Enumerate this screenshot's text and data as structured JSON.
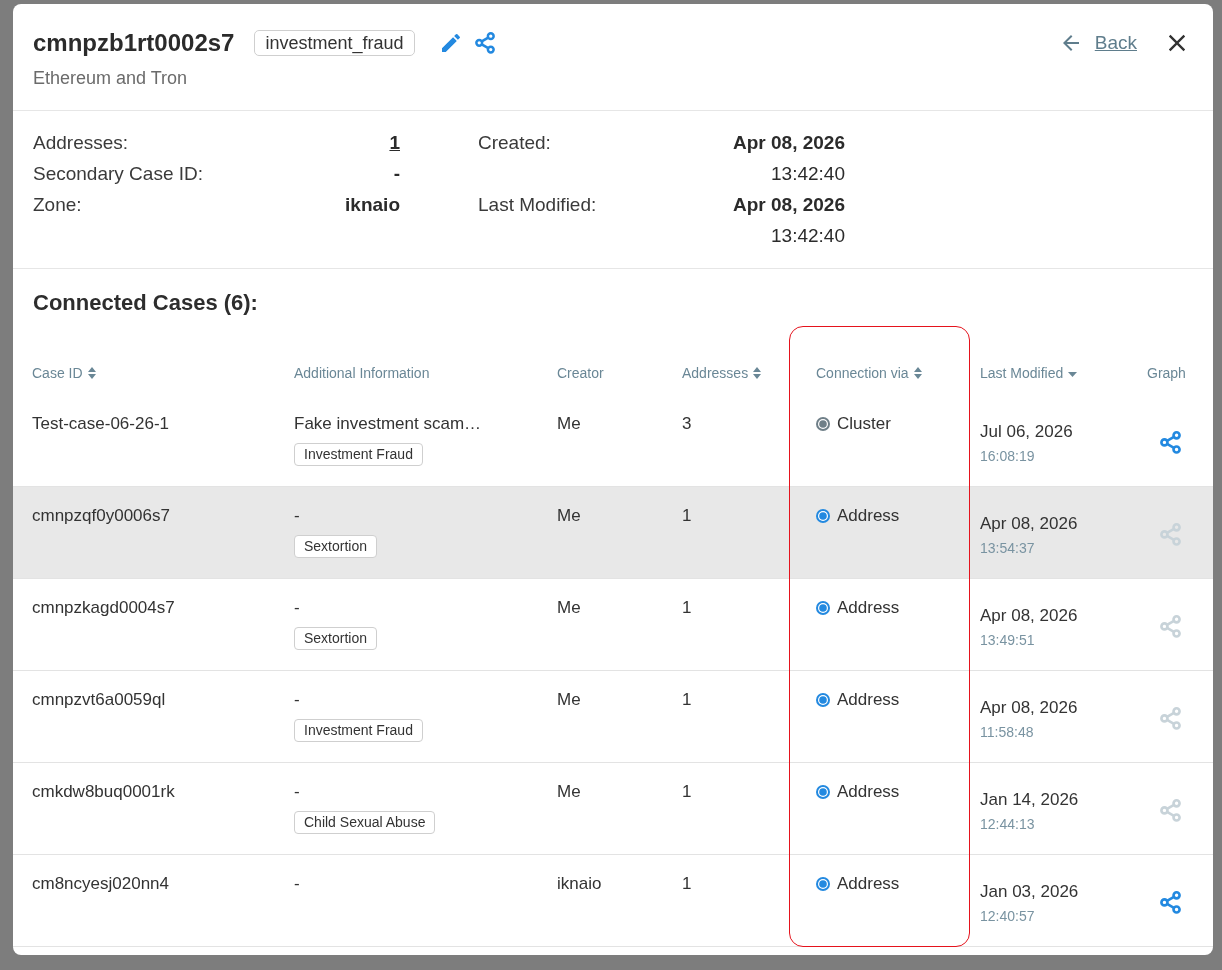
{
  "modal": {
    "title": "cmnpzb1rt0002s7",
    "tag": "investment_fraud",
    "subtitle": "Ethereum and Tron",
    "back_link": "Back"
  },
  "details": {
    "left": [
      {
        "label": "Addresses:",
        "value": "1",
        "kind": "link"
      },
      {
        "label": "Secondary Case ID:",
        "value": "-",
        "kind": "text"
      },
      {
        "label": "Zone:",
        "value": "iknaio",
        "kind": "text"
      }
    ],
    "right": [
      {
        "label": "Created:",
        "date": "Apr 08, 2026",
        "time": "13:42:40"
      },
      {
        "label": "Last Modified:",
        "date": "Apr 08, 2026",
        "time": "13:42:40"
      }
    ]
  },
  "connected_cases": {
    "title": "Connected Cases (6):"
  },
  "table": {
    "columns": [
      {
        "label": "Case ID",
        "kind": "sortable",
        "outlined": false
      },
      {
        "label": "Additional Information",
        "kind": "plain",
        "outlined": false
      },
      {
        "label": "Creator",
        "kind": "plain",
        "outlined": false
      },
      {
        "label": "Addresses",
        "kind": "sortable",
        "outlined": false
      },
      {
        "label": "Connection via",
        "kind": "sortable",
        "outlined": true
      },
      {
        "label": "Last Modified",
        "kind": "sorted",
        "outlined": false
      },
      {
        "label": "Graph",
        "kind": "plain",
        "outlined": false
      }
    ],
    "rows": [
      {
        "case_id": "Test-case-06-26-1",
        "info": "Fake investment scam…",
        "tag": "Investment Fraud",
        "creator": "Me",
        "addresses": "3",
        "connection": {
          "label": "Cluster",
          "color": "#6f7f88"
        },
        "date": "Jul 06, 2026",
        "time": "16:08:19",
        "graph_disabled": false,
        "selected": false
      },
      {
        "case_id": "cmnpzqf0y0006s7",
        "info": "-",
        "tag": "Sextortion",
        "creator": "Me",
        "addresses": "1",
        "connection": {
          "label": "Address",
          "color": "#2389e0"
        },
        "date": "Apr 08, 2026",
        "time": "13:54:37",
        "graph_disabled": true,
        "selected": true
      },
      {
        "case_id": "cmnpzkagd0004s7",
        "info": "-",
        "tag": "Sextortion",
        "creator": "Me",
        "addresses": "1",
        "connection": {
          "label": "Address",
          "color": "#2389e0"
        },
        "date": "Apr 08, 2026",
        "time": "13:49:51",
        "graph_disabled": true,
        "selected": false
      },
      {
        "case_id": "cmnpzvt6a0059ql",
        "info": "-",
        "tag": "Investment Fraud",
        "creator": "Me",
        "addresses": "1",
        "connection": {
          "label": "Address",
          "color": "#2389e0"
        },
        "date": "Apr 08, 2026",
        "time": "11:58:48",
        "graph_disabled": true,
        "selected": false
      },
      {
        "case_id": "cmkdw8buq0001rk",
        "info": "-",
        "tag": "Child Sexual Abuse",
        "creator": "Me",
        "addresses": "1",
        "connection": {
          "label": "Address",
          "color": "#2389e0"
        },
        "date": "Jan 14, 2026",
        "time": "12:44:13",
        "graph_disabled": true,
        "selected": false
      },
      {
        "case_id": "cm8ncyesj020nn4",
        "info": "-",
        "creator": "iknaio",
        "addresses": "1",
        "connection": {
          "label": "Address",
          "color": "#2389e0"
        },
        "date": "Jan 03, 2026",
        "time": "12:40:57",
        "graph_disabled": false,
        "selected": false
      }
    ]
  }
}
